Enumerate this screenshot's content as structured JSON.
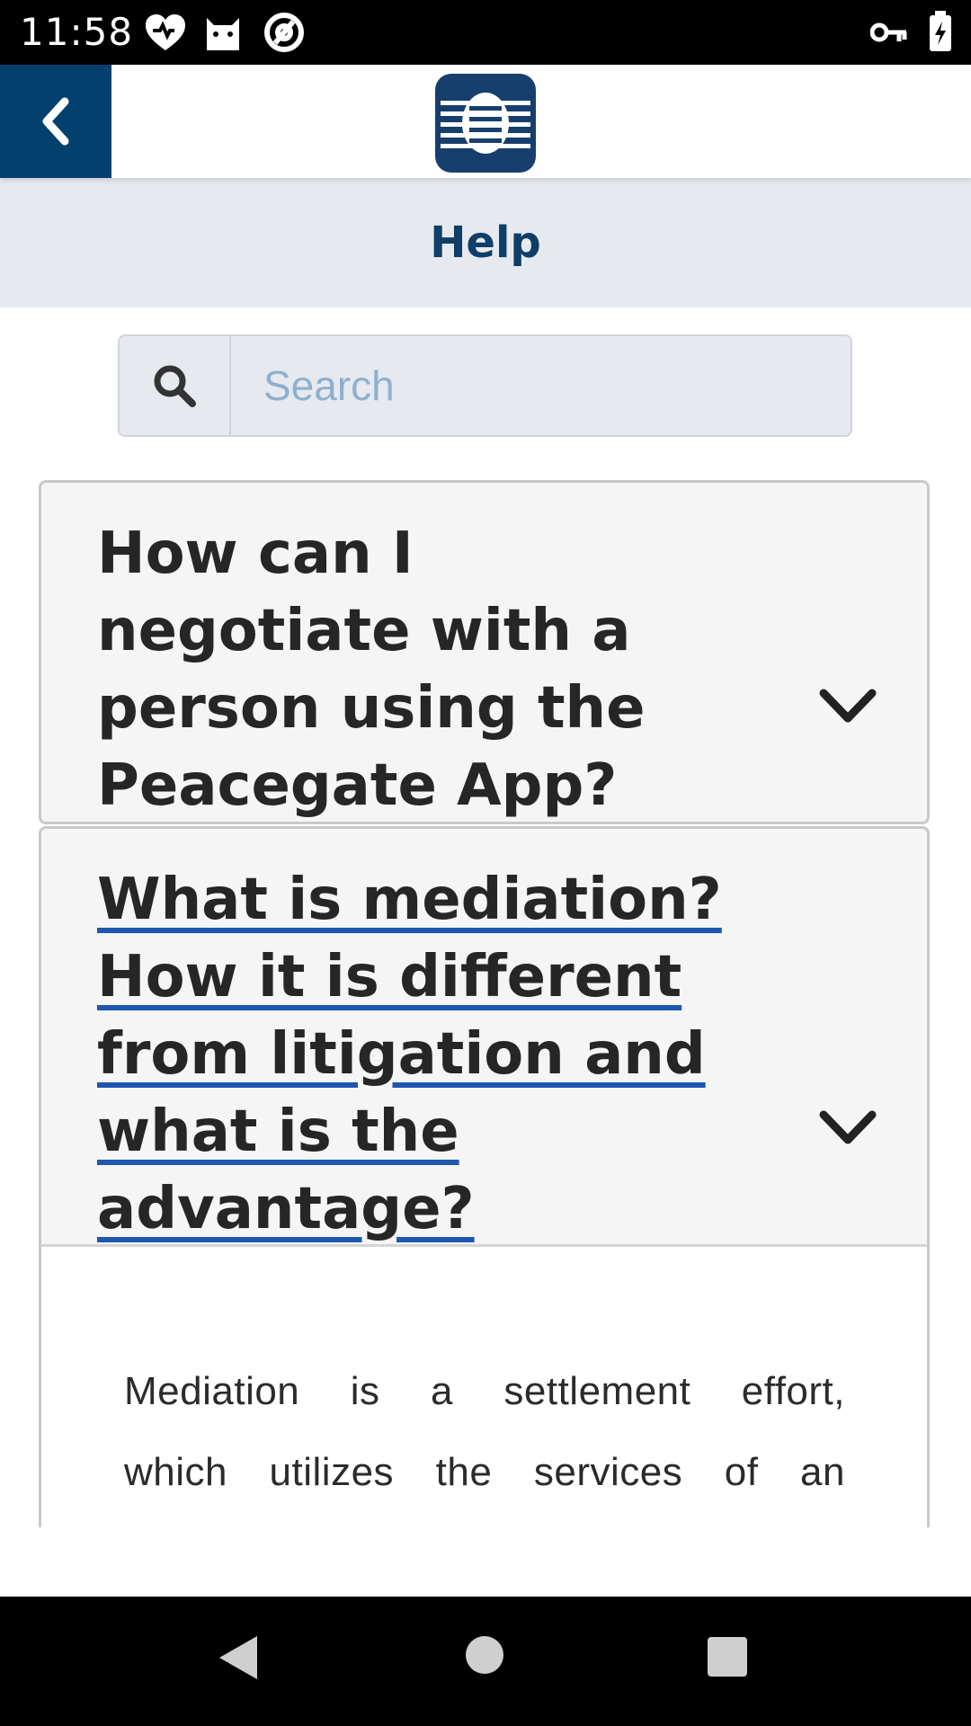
{
  "status_bar": {
    "time": "11:58",
    "icons": [
      "health-heart-icon",
      "cat-face-icon",
      "at-sign-icon",
      "vpn-key-icon",
      "battery-charging-icon"
    ]
  },
  "header": {
    "back_icon": "chevron-left-icon",
    "logo": "peacegate-logo",
    "accent_color": "#03406e"
  },
  "page": {
    "title": "Help"
  },
  "search": {
    "icon": "search-icon",
    "placeholder": "Search",
    "value": ""
  },
  "faq": [
    {
      "question": "How can I negotiate with a person using the Peacegate App?",
      "expanded": false,
      "chevron_icon": "chevron-down-icon"
    },
    {
      "question": "What is mediation? How it is different from litigation and what is the advantage?",
      "expanded": true,
      "chevron_icon": "chevron-down-icon",
      "answer_line_1": "Mediation is a settlement effort,",
      "answer_line_2": "which utilizes the services of an"
    }
  ],
  "nav_bar": {
    "buttons": [
      "back-triangle-icon",
      "home-circle-icon",
      "recents-square-icon"
    ]
  }
}
